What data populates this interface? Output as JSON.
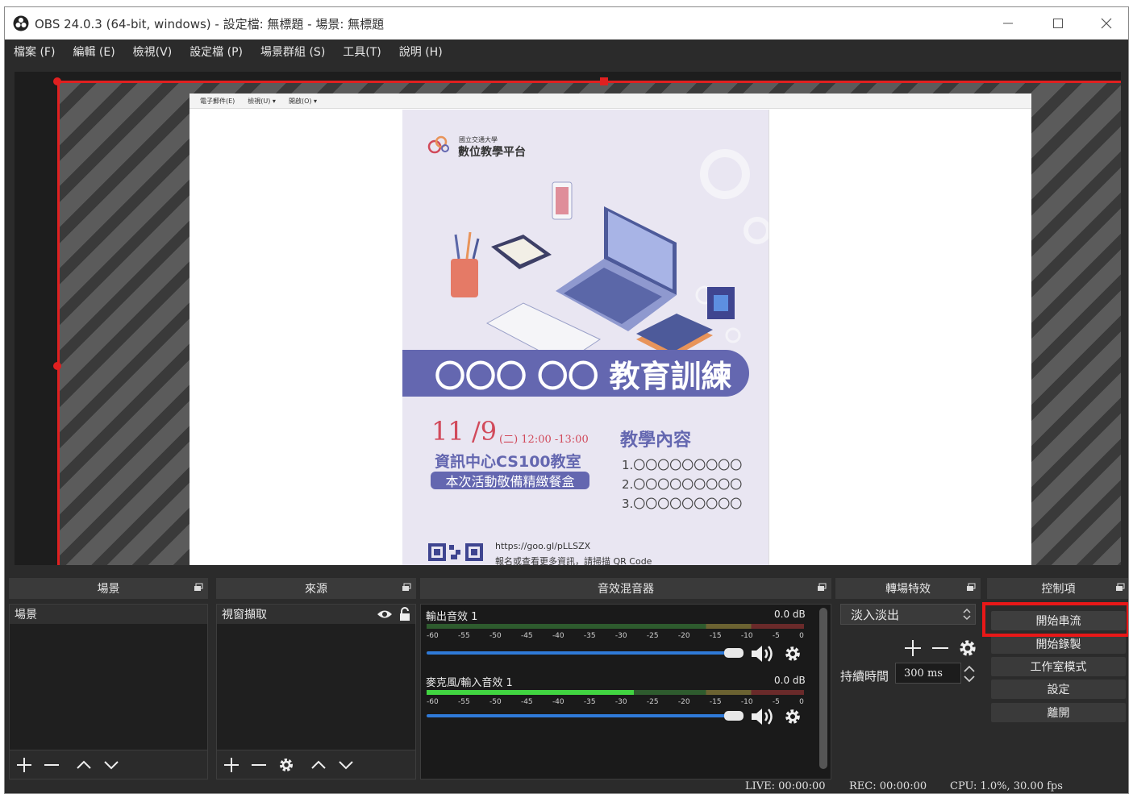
{
  "window": {
    "title": "OBS 24.0.3 (64-bit, windows) - 設定檔: 無標題 - 場景: 無標題",
    "controls": [
      "minimize-icon",
      "maximize-icon",
      "close-icon"
    ]
  },
  "menu": {
    "items": [
      {
        "label": "檔案 (F)"
      },
      {
        "label": "編輯 (E)"
      },
      {
        "label": "檢視(V)"
      },
      {
        "label": "設定檔 (P)"
      },
      {
        "label": "場景群組 (S)"
      },
      {
        "label": "工具(T)"
      },
      {
        "label": "說明 (H)"
      }
    ]
  },
  "preview": {
    "captured_menu": [
      "電子郵件(E)",
      "檢視(U) ▾",
      "開啟(O) ▾"
    ],
    "poster": {
      "brand_small": "國立交通大學",
      "brand_big": "數位教學平台",
      "banner": "〇〇〇 〇〇 教育訓練",
      "date_month": "11",
      "date_day": "/9",
      "time": "(二) 12:00 -13:00",
      "venue": "資訊中心CS100教室",
      "meal": "本次活動敬備精緻餐盒",
      "content_title": "教學內容",
      "content_items": [
        "1.〇〇〇〇〇〇〇〇〇",
        "2.〇〇〇〇〇〇〇〇〇",
        "3.〇〇〇〇〇〇〇〇〇"
      ],
      "url": "https://goo.gl/pLLSZX",
      "url_note": "報名或查看更多資訊，請掃描 QR Code"
    },
    "selection_color": "#e02020"
  },
  "docks": {
    "scenes": {
      "title": "場景",
      "items": [
        "場景"
      ]
    },
    "sources": {
      "title": "來源",
      "items": [
        "視窗擷取"
      ]
    },
    "mixer": {
      "title": "音效混音器",
      "scale": [
        "-60",
        "-55",
        "-50",
        "-45",
        "-40",
        "-35",
        "-30",
        "-25",
        "-20",
        "-15",
        "-10",
        "-5",
        "0"
      ],
      "tracks": [
        {
          "name": "輸出音效 1",
          "db": "0.0 dB",
          "level": 0.0
        },
        {
          "name": "麥克風/輸入音效 1",
          "db": "0.0 dB",
          "level": 0.55
        }
      ]
    },
    "transitions": {
      "title": "轉場特效",
      "selected": "淡入淡出",
      "duration_label": "持續時間",
      "duration_value": "300 ms"
    },
    "controls": {
      "title": "控制項",
      "buttons": [
        "開始串流",
        "開始錄製",
        "工作室模式",
        "設定",
        "離開"
      ],
      "highlight_color": "#e81818"
    }
  },
  "status": {
    "live": "LIVE: 00:00:00",
    "rec": "REC: 00:00:00",
    "cpu": "CPU: 1.0%, 30.00 fps"
  }
}
